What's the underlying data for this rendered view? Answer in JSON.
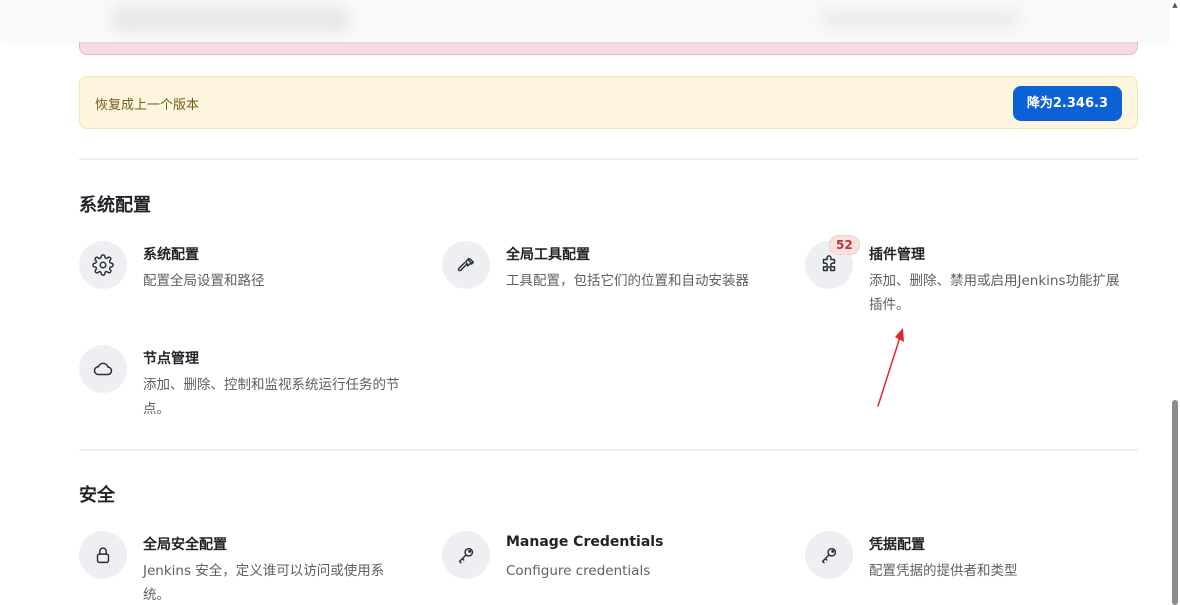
{
  "banner": {
    "message": "恢复成上一个版本",
    "button_label": "降为2.346.3"
  },
  "sections": [
    {
      "title": "系统配置",
      "tiles": [
        {
          "title": "系统配置",
          "description": "配置全局设置和路径",
          "icon": "gear-icon"
        },
        {
          "title": "全局工具配置",
          "description": "工具配置，包括它们的位置和自动安装器",
          "icon": "hammer-icon"
        },
        {
          "title": "插件管理",
          "description": "添加、删除、禁用或启用Jenkins功能扩展插件。",
          "icon": "puzzle-icon",
          "badge": "52"
        },
        {
          "title": "节点管理",
          "description": "添加、删除、控制和监视系统运行任务的节点。",
          "icon": "cloud-icon"
        }
      ]
    },
    {
      "title": "安全",
      "tiles": [
        {
          "title": "全局安全配置",
          "description": "Jenkins 安全，定义谁可以访问或使用系统。",
          "icon": "lock-icon"
        },
        {
          "title": "Manage Credentials",
          "description": "Configure credentials",
          "icon": "key-icon"
        },
        {
          "title": "凭据配置",
          "description": "配置凭据的提供者和类型",
          "icon": "key-icon"
        }
      ]
    }
  ],
  "colors": {
    "primary_button": "#0b62d6",
    "warning_bg": "#fdf5dd",
    "danger_bg": "#f6dbe0",
    "badge_text": "#b3353d",
    "annotation_arrow": "#e0282c"
  }
}
